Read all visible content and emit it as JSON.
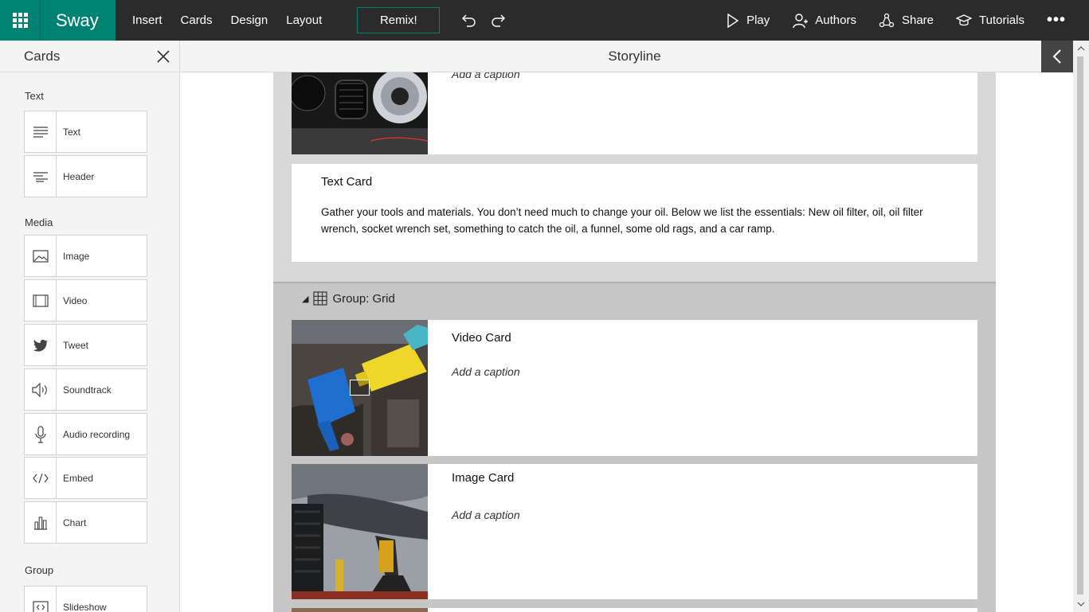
{
  "app": {
    "name": "Sway",
    "colors": {
      "brand": "#008272",
      "topbar": "#2b2b2b",
      "panel": "#f4f4f4"
    }
  },
  "menu": {
    "items": [
      "Insert",
      "Cards",
      "Design",
      "Layout"
    ],
    "remix": "Remix!"
  },
  "actions": {
    "play": "Play",
    "authors": "Authors",
    "share": "Share",
    "tutorials": "Tutorials",
    "more": "•••"
  },
  "cards_panel": {
    "title": "Cards",
    "sections": {
      "text": "Text",
      "media": "Media",
      "group": "Group"
    },
    "text_items": [
      {
        "label": "Text",
        "icon": "text-lines-icon"
      },
      {
        "label": "Header",
        "icon": "header-icon"
      }
    ],
    "media_items": [
      {
        "label": "Image",
        "icon": "image-icon"
      },
      {
        "label": "Video",
        "icon": "video-icon"
      },
      {
        "label": "Tweet",
        "icon": "twitter-icon"
      },
      {
        "label": "Soundtrack",
        "icon": "speaker-icon"
      },
      {
        "label": "Audio recording",
        "icon": "microphone-icon"
      },
      {
        "label": "Embed",
        "icon": "code-icon"
      },
      {
        "label": "Chart",
        "icon": "chart-icon"
      }
    ],
    "group_items": [
      {
        "label": "Slideshow",
        "icon": "slideshow-icon"
      }
    ]
  },
  "storyline": {
    "title": "Storyline",
    "top_card": {
      "caption": "Add a caption"
    },
    "text_card": {
      "title": "Text Card",
      "body": "Gather your tools and materials. You don’t need much to change your oil. Below we list the essentials: New oil filter, oil, oil filter wrench, socket wrench set, something to catch the oil, a funnel, some old rags, and a car ramp."
    },
    "group": {
      "title": "Group: Grid",
      "video_card": {
        "heading": "Video Card",
        "caption": "Add a caption"
      },
      "image_card": {
        "heading": "Image Card",
        "caption": "Add a caption"
      }
    }
  }
}
